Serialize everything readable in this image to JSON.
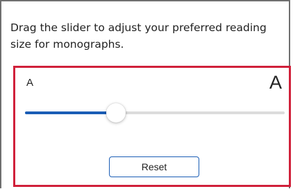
{
  "instruction": "Drag the slider to adjust your preferred reading size for monographs.",
  "slider": {
    "min_label": "A",
    "max_label": "A",
    "value_fraction": 0.35
  },
  "reset_label": "Reset",
  "colors": {
    "accent": "#1a5db5",
    "highlight_border": "#d0203a",
    "track": "#dcdcdc"
  }
}
